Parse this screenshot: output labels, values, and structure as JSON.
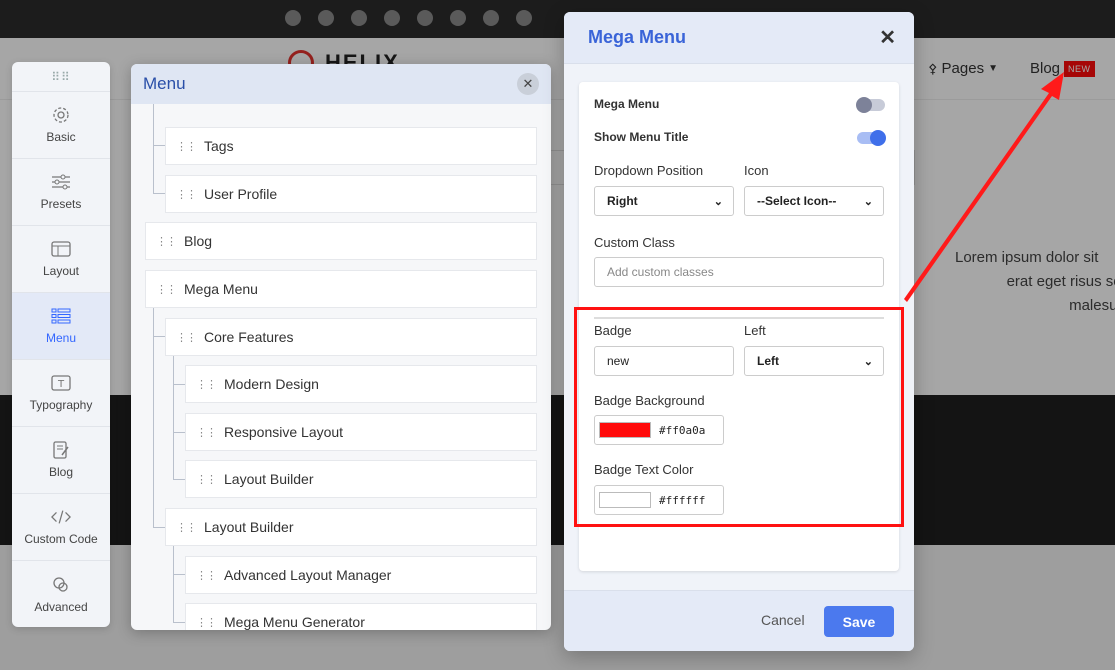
{
  "site": {
    "logo_text": "HELIX",
    "nav_pages": "Pages",
    "nav_blog": "Blog",
    "nav_blog_badge": "NEW",
    "lorem_lines": [
      "Lorem ipsum dolor sit",
      "erat eget risus sollicitu",
      "malesuada e"
    ]
  },
  "sidebar": {
    "items": [
      {
        "label": "Basic",
        "icon": "gear-icon"
      },
      {
        "label": "Presets",
        "icon": "sliders-icon"
      },
      {
        "label": "Layout",
        "icon": "layout-icon"
      },
      {
        "label": "Menu",
        "icon": "menu-icon"
      },
      {
        "label": "Typography",
        "icon": "typography-icon"
      },
      {
        "label": "Blog",
        "icon": "blog-icon"
      },
      {
        "label": "Custom Code",
        "icon": "code-icon"
      },
      {
        "label": "Advanced",
        "icon": "advanced-icon"
      }
    ]
  },
  "menu_panel": {
    "title": "Menu",
    "items": [
      {
        "label": "Tags"
      },
      {
        "label": "User Profile"
      },
      {
        "label": "Blog"
      },
      {
        "label": "Mega Menu"
      },
      {
        "label": "Core Features"
      },
      {
        "label": "Modern Design"
      },
      {
        "label": "Responsive Layout"
      },
      {
        "label": "Layout Builder"
      },
      {
        "label": "Layout Builder"
      },
      {
        "label": "Advanced Layout Manager"
      },
      {
        "label": "Mega Menu Generator"
      }
    ]
  },
  "modal": {
    "title": "Mega Menu",
    "mega_menu_label": "Mega Menu",
    "show_title_label": "Show Menu Title",
    "dropdown_position_label": "Dropdown Position",
    "dropdown_position_value": "Right",
    "icon_label": "Icon",
    "icon_value": "--Select Icon--",
    "custom_class_label": "Custom Class",
    "custom_class_placeholder": "Add custom classes",
    "badge_label": "Badge",
    "badge_value": "new",
    "badge_position_label": "Left",
    "badge_position_value": "Left",
    "badge_bg_label": "Badge Background",
    "badge_bg_hex": "#ff0a0a",
    "badge_text_color_label": "Badge Text Color",
    "badge_text_color_hex": "#ffffff",
    "cancel_label": "Cancel",
    "save_label": "Save",
    "mega_menu_enabled": false,
    "show_title_enabled": true
  },
  "colors": {
    "accent": "#4b79ee",
    "highlight": "#ff1111",
    "badge_bg": "#ff0a0a",
    "badge_text": "#ffffff"
  }
}
